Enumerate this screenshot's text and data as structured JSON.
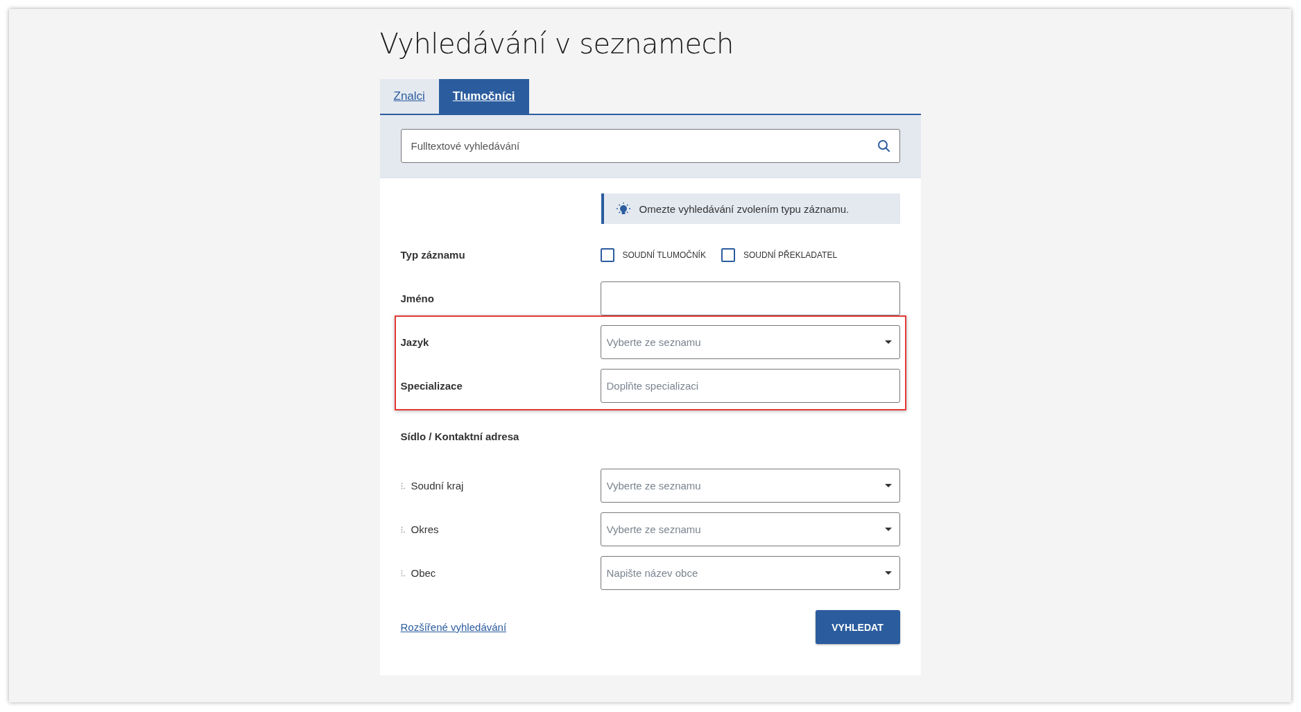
{
  "page_title": "Vyhledávání v seznamech",
  "tabs": [
    {
      "label": "Znalci",
      "selected": false
    },
    {
      "label": "Tlumočníci",
      "selected": true
    }
  ],
  "search": {
    "placeholder": "Fulltextové vyhledávání"
  },
  "hint": "Omezte vyhledávání zvolením typu záznamu.",
  "rows": [
    {
      "kind": "checkboxes",
      "label": "Typ záznamu",
      "options": [
        {
          "label": "SOUDNÍ TLUMOČNÍK",
          "checked": false
        },
        {
          "label": "SOUDNÍ PŘEKLADATEL",
          "checked": false
        }
      ],
      "highlighted": false
    },
    {
      "kind": "text",
      "label": "Jméno",
      "highlighted": false
    },
    {
      "kind": "select",
      "label": "Jazyk",
      "placeholder": "Vyberte ze seznamu",
      "highlighted": true
    },
    {
      "kind": "text",
      "label": "Specializace",
      "placeholder": "Doplňte specializaci",
      "highlighted": true
    },
    {
      "kind": "heading",
      "label": "Sídlo / Kontaktní adresa",
      "highlighted": false
    },
    {
      "kind": "select",
      "label": "Soudní kraj",
      "placeholder": "Vyberte ze seznamu",
      "indented": true,
      "highlighted": false
    },
    {
      "kind": "select",
      "label": "Okres",
      "placeholder": "Vyberte ze seznamu",
      "indented": true,
      "highlighted": false
    },
    {
      "kind": "select",
      "label": "Obec",
      "placeholder": "Napište název obce",
      "indented": true,
      "highlighted": false
    }
  ],
  "advanced_link": "Rozšířené vyhledávání",
  "submit_button": "VYHLEDAT"
}
